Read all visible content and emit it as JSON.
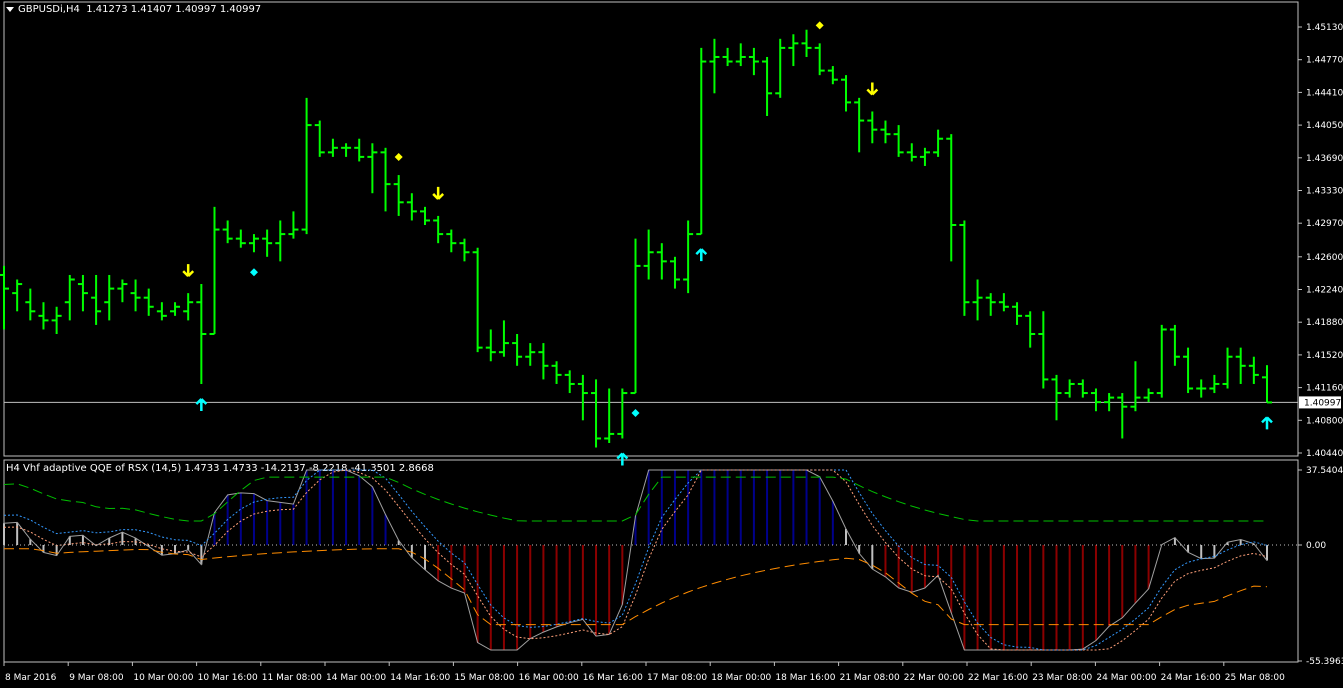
{
  "main_header": {
    "symbol": "GBPUSDi,H4",
    "ohlc": "1.41273 1.41407 1.40997 1.40997"
  },
  "indicator_header": {
    "title": "H4 Vhf adaptive QQE of RSX (14,5) 1.4733 1.4733 -14.2137 -8.2218 -41.3501 2.8668"
  },
  "price_axis": [
    "1.45130",
    "1.44770",
    "1.44410",
    "1.44050",
    "1.43690",
    "1.43330",
    "1.42970",
    "1.42600",
    "1.42240",
    "1.41880",
    "1.41520",
    "1.41160",
    "1.40800",
    "1.40440"
  ],
  "current_price": "1.40997",
  "indicator_axis": {
    "top": "37.5404",
    "zero": "0.00",
    "bottom": "-55.3963"
  },
  "time_axis": [
    "8 Mar 2016",
    "9 Mar 08:00",
    "10 Mar 00:00",
    "10 Mar 16:00",
    "11 Mar 08:00",
    "14 Mar 00:00",
    "14 Mar 16:00",
    "15 Mar 08:00",
    "16 Mar 00:00",
    "16 Mar 16:00",
    "17 Mar 08:00",
    "18 Mar 00:00",
    "18 Mar 16:00",
    "21 Mar 08:00",
    "22 Mar 00:00",
    "22 Mar 16:00",
    "23 Mar 08:00",
    "24 Mar 00:00",
    "24 Mar 16:00",
    "25 Mar 08:00"
  ],
  "colors": {
    "bull_bar": "#00ff00",
    "up_arrow": "#00ffff",
    "down_arrow": "#ffff00",
    "hist_neg": "#8b0000",
    "hist_pos": "#00008b",
    "hist_neutral": "#c0c0c0",
    "level_line": "#ff8c00",
    "upper_level": "#00c000"
  },
  "chart_data": {
    "type": "ohlc",
    "title": "GBPUSDi,H4",
    "ylim": [
      1.4044,
      1.453
    ],
    "bars": [
      [
        1.424,
        1.425,
        1.418,
        1.4225
      ],
      [
        1.422,
        1.4235,
        1.42,
        1.423
      ],
      [
        1.421,
        1.4225,
        1.419,
        1.42
      ],
      [
        1.4195,
        1.421,
        1.418,
        1.419
      ],
      [
        1.419,
        1.4205,
        1.4175,
        1.4195
      ],
      [
        1.421,
        1.424,
        1.419,
        1.4235
      ],
      [
        1.423,
        1.424,
        1.42,
        1.422
      ],
      [
        1.4215,
        1.424,
        1.4185,
        1.42
      ],
      [
        1.421,
        1.424,
        1.419,
        1.4225
      ],
      [
        1.4225,
        1.4235,
        1.421,
        1.423
      ],
      [
        1.422,
        1.4235,
        1.42,
        1.4215
      ],
      [
        1.4215,
        1.4225,
        1.4195,
        1.4205
      ],
      [
        1.42,
        1.421,
        1.419,
        1.4195
      ],
      [
        1.42,
        1.421,
        1.4195,
        1.4205
      ],
      [
        1.42,
        1.422,
        1.419,
        1.421
      ],
      [
        1.421,
        1.423,
        1.412,
        1.4175
      ],
      [
        1.4175,
        1.4315,
        1.4175,
        1.429
      ],
      [
        1.429,
        1.43,
        1.4275,
        1.428
      ],
      [
        1.428,
        1.429,
        1.427,
        1.4275
      ],
      [
        1.4275,
        1.4285,
        1.4265,
        1.428
      ],
      [
        1.428,
        1.429,
        1.426,
        1.4275
      ],
      [
        1.4275,
        1.43,
        1.4255,
        1.4285
      ],
      [
        1.4285,
        1.431,
        1.428,
        1.429
      ],
      [
        1.429,
        1.4435,
        1.4285,
        1.4405
      ],
      [
        1.4405,
        1.441,
        1.437,
        1.4375
      ],
      [
        1.4375,
        1.439,
        1.437,
        1.438
      ],
      [
        1.438,
        1.4385,
        1.437,
        1.438
      ],
      [
        1.438,
        1.439,
        1.4365,
        1.437
      ],
      [
        1.437,
        1.4385,
        1.433,
        1.4375
      ],
      [
        1.4375,
        1.438,
        1.431,
        1.434
      ],
      [
        1.434,
        1.435,
        1.4305,
        1.432
      ],
      [
        1.432,
        1.433,
        1.43,
        1.431
      ],
      [
        1.431,
        1.4315,
        1.4295,
        1.43
      ],
      [
        1.43,
        1.4305,
        1.4275,
        1.4285
      ],
      [
        1.4285,
        1.429,
        1.4265,
        1.4275
      ],
      [
        1.4275,
        1.428,
        1.4255,
        1.4265
      ],
      [
        1.4265,
        1.427,
        1.4155,
        1.416
      ],
      [
        1.416,
        1.418,
        1.4145,
        1.4155
      ],
      [
        1.4155,
        1.419,
        1.415,
        1.4165
      ],
      [
        1.4165,
        1.4175,
        1.414,
        1.415
      ],
      [
        1.415,
        1.4165,
        1.414,
        1.4155
      ],
      [
        1.4155,
        1.4165,
        1.4125,
        1.414
      ],
      [
        1.414,
        1.4145,
        1.412,
        1.413
      ],
      [
        1.413,
        1.4135,
        1.411,
        1.412
      ],
      [
        1.412,
        1.413,
        1.408,
        1.411
      ],
      [
        1.411,
        1.4125,
        1.405,
        1.406
      ],
      [
        1.406,
        1.4115,
        1.4055,
        1.4065
      ],
      [
        1.4065,
        1.4115,
        1.406,
        1.411
      ],
      [
        1.411,
        1.428,
        1.411,
        1.425
      ],
      [
        1.425,
        1.429,
        1.4235,
        1.4265
      ],
      [
        1.4265,
        1.4275,
        1.4235,
        1.4255
      ],
      [
        1.4255,
        1.426,
        1.4225,
        1.4235
      ],
      [
        1.4235,
        1.43,
        1.422,
        1.4285
      ],
      [
        1.4285,
        1.449,
        1.4285,
        1.4475
      ],
      [
        1.4475,
        1.45,
        1.444,
        1.448
      ],
      [
        1.448,
        1.449,
        1.447,
        1.4475
      ],
      [
        1.4475,
        1.4495,
        1.447,
        1.448
      ],
      [
        1.448,
        1.449,
        1.446,
        1.4475
      ],
      [
        1.4475,
        1.448,
        1.4415,
        1.444
      ],
      [
        1.444,
        1.45,
        1.4435,
        1.449
      ],
      [
        1.449,
        1.4505,
        1.447,
        1.4495
      ],
      [
        1.4495,
        1.451,
        1.448,
        1.449
      ],
      [
        1.449,
        1.4495,
        1.446,
        1.4465
      ],
      [
        1.4465,
        1.447,
        1.445,
        1.4455
      ],
      [
        1.4455,
        1.446,
        1.442,
        1.443
      ],
      [
        1.443,
        1.4435,
        1.4375,
        1.441
      ],
      [
        1.441,
        1.442,
        1.4385,
        1.44
      ],
      [
        1.44,
        1.441,
        1.4385,
        1.4395
      ],
      [
        1.4395,
        1.4405,
        1.437,
        1.4375
      ],
      [
        1.4375,
        1.4385,
        1.4365,
        1.437
      ],
      [
        1.437,
        1.438,
        1.436,
        1.4375
      ],
      [
        1.4375,
        1.44,
        1.437,
        1.439
      ],
      [
        1.439,
        1.4395,
        1.4255,
        1.4295
      ],
      [
        1.4295,
        1.43,
        1.4195,
        1.421
      ],
      [
        1.421,
        1.4235,
        1.419,
        1.4215
      ],
      [
        1.4215,
        1.422,
        1.4195,
        1.421
      ],
      [
        1.421,
        1.422,
        1.42,
        1.4205
      ],
      [
        1.4205,
        1.421,
        1.4185,
        1.4195
      ],
      [
        1.4195,
        1.42,
        1.416,
        1.4175
      ],
      [
        1.4175,
        1.42,
        1.4115,
        1.4125
      ],
      [
        1.4125,
        1.413,
        1.408,
        1.411
      ],
      [
        1.411,
        1.4125,
        1.4105,
        1.412
      ],
      [
        1.412,
        1.4125,
        1.4105,
        1.411
      ],
      [
        1.411,
        1.4115,
        1.409,
        1.41
      ],
      [
        1.41,
        1.411,
        1.409,
        1.4105
      ],
      [
        1.4105,
        1.411,
        1.406,
        1.4095
      ],
      [
        1.4095,
        1.4145,
        1.409,
        1.4105
      ],
      [
        1.4105,
        1.4115,
        1.41,
        1.411
      ],
      [
        1.411,
        1.4185,
        1.4105,
        1.418
      ],
      [
        1.418,
        1.4185,
        1.414,
        1.415
      ],
      [
        1.415,
        1.416,
        1.411,
        1.4115
      ],
      [
        1.4115,
        1.4125,
        1.4105,
        1.4115
      ],
      [
        1.4115,
        1.413,
        1.411,
        1.412
      ],
      [
        1.412,
        1.416,
        1.4115,
        1.415
      ],
      [
        1.415,
        1.416,
        1.412,
        1.414
      ],
      [
        1.414,
        1.415,
        1.412,
        1.413
      ],
      [
        1.41273,
        1.41407,
        1.40997,
        1.40997
      ]
    ],
    "up_arrows": [
      15,
      47,
      53,
      96
    ],
    "down_arrows": [
      14,
      33,
      66
    ],
    "diamonds_yellow": [
      30,
      62
    ],
    "diamonds_cyan": [
      19,
      48
    ]
  }
}
